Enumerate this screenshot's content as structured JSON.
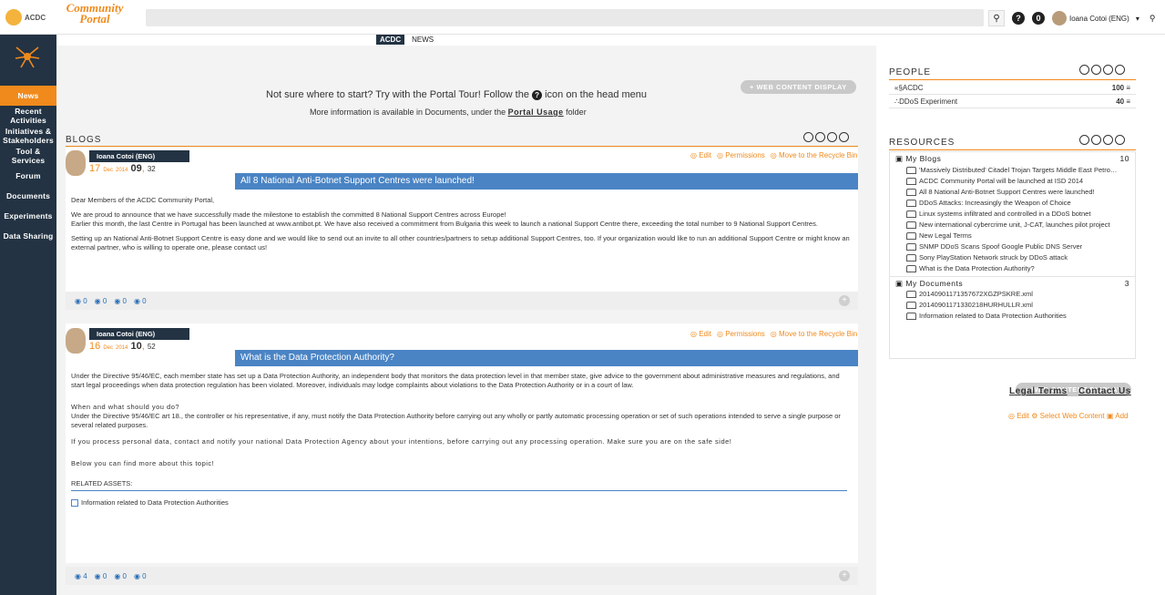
{
  "header": {
    "logo_text": "ACDC",
    "portal_title": "Community Portal",
    "search_icon": "search-icon",
    "help_icon_glyph": "?",
    "notifications_count": "0",
    "user_name": "Ioana Cotoi (ENG)"
  },
  "sidebar": {
    "items": [
      {
        "label": "News",
        "active": true
      },
      {
        "label": "Recent Activities"
      },
      {
        "label": "Initiatives & Stakeholders"
      },
      {
        "label": "Tool & Services"
      },
      {
        "label": "Forum"
      },
      {
        "label": "Documents"
      },
      {
        "label": "Experiments"
      },
      {
        "label": "Data Sharing"
      }
    ]
  },
  "tabs": [
    {
      "label": "ACDC",
      "active": true
    },
    {
      "label": "NEWS"
    }
  ],
  "intro": {
    "wcd_label": "+ WEB CONTENT DISPLAY",
    "line1_a": "Not sure where to start? Try with the Portal Tour!   Follow the",
    "line1_b": "icon on the head menu",
    "line2_a": "More information is available in Documents, under the",
    "line2_link": "Portal Usage",
    "line2_b": "folder"
  },
  "blogs": {
    "title": "BLOGS",
    "action_edit": "Edit",
    "action_permissions": "Permissions",
    "action_recycle": "Move to the Recycle Bin",
    "entries": [
      {
        "author": "Ioana Cotoi (ENG)",
        "day": "17",
        "month": "Dec",
        "year": "2014",
        "time_h": "09",
        "time_m": "32",
        "title": "All 8 National Anti-Botnet Support Centres were launched!",
        "p1": "Dear Members of the ACDC Community Portal,",
        "p2": "We are proud to announce that we have successfully made the milestone to establish the committed 8 National Support Centres across Europe!",
        "p3": "Earlier this month, the last Centre in Portugal has been launched at www.antibot.pt. We have also received a commitment from Bulgaria this week to launch a national Support Centre there, exceeding the total number to 9 National Support Centres.",
        "p4": "Setting up an National Anti-Botnet Support Centre is easy done and we would like to send out an invite to all other countries/partners to setup additional Support Centres, too. If your organization would like to run an additional Support Centre or might know an external partner, who is willing to operate one, please contact us!",
        "stats": [
          "0",
          "0",
          "0",
          "0"
        ]
      },
      {
        "author": "Ioana Cotoi (ENG)",
        "day": "16",
        "month": "Dec",
        "year": "2014",
        "time_h": "10",
        "time_m": "52",
        "title": "What is the Data Protection Authority?",
        "p1": "Under the Directive 95/46/EC, each member state has set up a Data Protection Authority, an independent body that monitors the data protection level in that member state, give advice to the government about administrative measures and regulations, and start legal proceedings when data protection regulation has been violated. Moreover, individuals may lodge complaints about violations to the Data Protection Authority or in a court of law.",
        "h2": "When and what should you do?",
        "p2": "Under the Directive 95/46/EC art 18., the controller or his representative, if any, must notify the Data Protection Authority before carrying out any wholly or partly automatic processing operation or set of such operations intended to serve a single purpose or several related purposes.",
        "p3": "If you process personal data, contact and notify your national Data Protection Agency about your intentions, before carrying out any processing operation. Make sure you are on the safe side!",
        "p4": "Below you can find more about this topic!",
        "related_title": "RELATED ASSETS:",
        "related_item": "Information related to Data Protection Authorities",
        "stats": [
          "4",
          "0",
          "0",
          "0"
        ]
      }
    ]
  },
  "people": {
    "title": "PEOPLE",
    "rows": [
      {
        "name": "«§ACDC",
        "count": "100"
      },
      {
        "name": "∴DDoS Experiment",
        "count": "40"
      }
    ]
  },
  "resources": {
    "title": "RESOURCES",
    "blogs_label": "My Blogs",
    "blogs_count": "10",
    "blog_items": [
      "'Massively Distributed' Citadel Trojan Targets Middle East Petrochemical",
      "ACDC Community Portal will be launched at ISD 2014",
      "All 8 National Anti-Botnet Support Centres were launched!",
      "DDoS Attacks: Increasingly the Weapon of Choice",
      "Linux systems infiltrated and controlled in a DDoS botnet",
      "New international cybercrime unit, J-CAT, launches pilot project",
      "New Legal Terms",
      "SNMP DDoS Scans Spoof Google Public DNS Server",
      "Sony PlayStation Network struck by DDoS attack",
      "What is the Data Protection Authority?"
    ],
    "docs_label": "My Documents",
    "docs_count": "3",
    "doc_items": [
      "20140901171357672XGZPSKRE.xml",
      "20140901171330218HURHULLR.xml",
      "Information related to Data Protection Authorities"
    ]
  },
  "footer_links": {
    "wcd_label": "+ WEB CONTENT DISPLAY",
    "legal": "Legal Terms",
    "contact": "Contact Us",
    "edit": "Edit",
    "select": "Select Web Content",
    "add": "Add"
  },
  "colors": {
    "accent": "#f08a1c",
    "sidebar": "#233343",
    "title_band": "#4a84c4"
  }
}
